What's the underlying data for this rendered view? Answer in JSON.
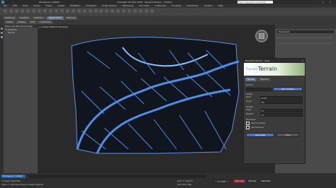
{
  "app": {
    "title": "Autodesk 3ds Max 2018 - Student Version - Untitled",
    "workspace": "Workspace: Default",
    "search_placeholder": "Type a keyword or phrase"
  },
  "menubar": {
    "items": [
      "File",
      "Edit",
      "Tools",
      "Group",
      "Views",
      "Create",
      "Modifiers",
      "Animation",
      "Graph Editors",
      "Rendering",
      "Civil View",
      "Customize",
      "Scripting",
      "Interactive",
      "Content",
      "Help"
    ]
  },
  "command_tabs": [
    "Modeling",
    "Freeform",
    "Selection",
    "Object Paint",
    "Populate"
  ],
  "explorer": {
    "tabs": [
      "Select",
      "Display",
      "Edit",
      "Customize"
    ],
    "header": "Name (Sorted Ascending)",
    "items": [
      "0 (default)",
      "Terrain"
    ]
  },
  "viewport": {
    "label": "[+] [Top] [Default Shading]"
  },
  "right_panel": {
    "selection_name": "Terrain001"
  },
  "window": {
    "title": "Populate Terrain - View",
    "logo_prefix": "Populate",
    "logo_main": "Terrain",
    "tabs": [
      "Terrain",
      "Objects"
    ],
    "sections": {
      "surface": "Surface",
      "scatter": "Scatter",
      "density": "Density",
      "placement": "Placement"
    },
    "buttons": {
      "pick_surface": "Pick Surface",
      "generate": "Generate",
      "clear": "Clear"
    },
    "labels": {
      "seed": "Seed",
      "count": "Count",
      "scale": "Scale",
      "rotation": "Rotation",
      "align": "Align to surface",
      "use_instances": "Use Instances"
    },
    "values": {
      "seed": "12345",
      "count": "500",
      "scale": "1.0",
      "rotation": "0.0"
    }
  },
  "statusbar": {
    "workspace_label": "Workspace: Default",
    "message": "Click or click-and-drag to select objects",
    "selected": "1 Object Selected",
    "grid": "Grid = 10.0cm",
    "add_time_tag": "Add Time Tag",
    "frame": "0 / 100",
    "auto_key": "Auto Key",
    "set_key": "Set Key",
    "selected_label": "Selected"
  },
  "colors": {
    "mesh": "#4f8fe8",
    "logo_blue": "#1b2c44",
    "accent": "#5a6c86"
  }
}
